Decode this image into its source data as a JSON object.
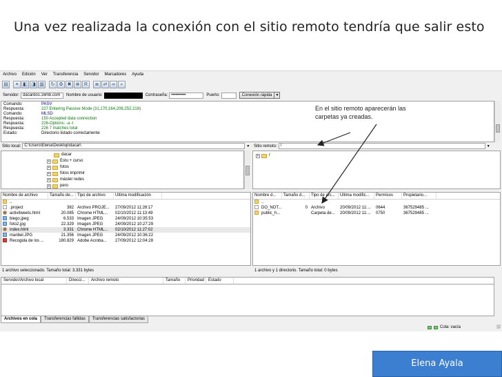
{
  "slide": {
    "title": "Una vez realizada la conexión con el sitio remoto tendría que salir esto",
    "author": "Elena Ayala"
  },
  "menu": [
    "Archivo",
    "Edición",
    "Ver",
    "Transferencia",
    "Servidor",
    "Marcadores",
    "Ayuda"
  ],
  "quickconnect": {
    "server_label": "Servidor:",
    "server_value": "dacardos.16mb.com",
    "user_label": "Nombre de usuario:",
    "user_value": "",
    "password_label": "Contraseña:",
    "password_value": "••••••••••",
    "port_label": "Puerto:",
    "port_value": "",
    "connect_button": "Conexión rápida",
    "dropdown": "▼"
  },
  "log": [
    {
      "kind": "Comando:",
      "msg": "PASV",
      "type": "cmd"
    },
    {
      "kind": "Respuesta:",
      "msg": "227 Entering Passive Mode (31,170,164,206,252,218)",
      "type": "resp"
    },
    {
      "kind": "Comando:",
      "msg": "MLSD",
      "type": "cmd"
    },
    {
      "kind": "Respuesta:",
      "msg": "150 Accepted data connection",
      "type": "resp"
    },
    {
      "kind": "Respuesta:",
      "msg": "226-Options: -a -l",
      "type": "resp"
    },
    {
      "kind": "Respuesta:",
      "msg": "226 7 matches total",
      "type": "resp"
    },
    {
      "kind": "Estado:",
      "msg": "Directorio listado correctamente",
      "type": "stat"
    }
  ],
  "annotation": {
    "line1": "En el sitio remoto aparecerán las",
    "line2": "carpetas ya creadas."
  },
  "local": {
    "path_label": "Sitio local:",
    "path_value": "C:\\Users\\Elena\\Desktop\\dacar\\",
    "tree": [
      "dacar",
      "Estu + curso",
      "fotos",
      "fotos imprimir",
      "máster redes",
      "pero"
    ],
    "columns": [
      "Nombre de archivo",
      "Tamaño de...",
      "Tipo de archivo",
      "Última modificación"
    ],
    "files": [
      {
        "name": "..",
        "size": "",
        "type": "",
        "modified": "",
        "icon": "folder"
      },
      {
        "name": ".project",
        "size": "382",
        "type": "Archivo PROJE...",
        "modified": "27/09/2012 11:28:17",
        "icon": "file"
      },
      {
        "name": "activitweets.html",
        "size": "20.085",
        "type": "Chrome HTML...",
        "modified": "02/10/2012 11:13:49",
        "icon": "chrome"
      },
      {
        "name": "biego.jpeg",
        "size": "6.533",
        "type": "Imagen JPEG",
        "modified": "24/09/2012 10:35:53",
        "icon": "jpeg"
      },
      {
        "name": "foto2.jpg",
        "size": "22.329",
        "type": "Imagen JPEG",
        "modified": "24/09/2012 10:27:29",
        "icon": "jpeg"
      },
      {
        "name": "index.html",
        "size": "3.331",
        "type": "Chrome HTML...",
        "modified": "02/10/2012 11:27:02",
        "icon": "chrome"
      },
      {
        "name": "manbel.JPG",
        "size": "21.356",
        "type": "Imagen JPEG",
        "modified": "24/09/2012 10:36:22",
        "icon": "jpeg"
      },
      {
        "name": "Recogida de los ...",
        "size": "180.829",
        "type": "Adobe Acroba...",
        "modified": "27/09/2012 12:04:28",
        "icon": "pdf"
      }
    ],
    "selected_row": "index.html",
    "status": "1 archivo seleccionado. Tamaño total: 3.331 bytes"
  },
  "remote": {
    "path_label": "Sitio remoto:",
    "path_value": "/",
    "tree": [
      "/"
    ],
    "columns": [
      "Nombre d...",
      "Tamaño d...",
      "Tipo de arc...",
      "Última modific...",
      "Permisos",
      "Propietario..."
    ],
    "files": [
      {
        "name": "..",
        "size": "",
        "type": "",
        "modified": "",
        "perms": "",
        "owner": "",
        "icon": "folder"
      },
      {
        "name": "DO_NOT...",
        "size": "0",
        "type": "Archivo",
        "modified": "20/09/2012 11:...",
        "perms": "0644",
        "owner": "367529485 ...",
        "icon": "file"
      },
      {
        "name": "public_h...",
        "size": "",
        "type": "Carpeta de...",
        "modified": "20/09/2012 11:...",
        "perms": "0750",
        "owner": "367529485 ...",
        "icon": "folder"
      }
    ],
    "status": "1 archivo y 1 directorio. Tamaño total: 0 bytes"
  },
  "queue": {
    "columns": [
      "Servidor/Archivo local",
      "Direcci...",
      "Archivo remoto",
      "Tamaño",
      "Prioridad",
      "Estado"
    ],
    "tabs": [
      "Archivos en cola",
      "Transferencias fallidas",
      "Transferencias satisfactorias"
    ],
    "status_text": "Cola: vacía"
  }
}
